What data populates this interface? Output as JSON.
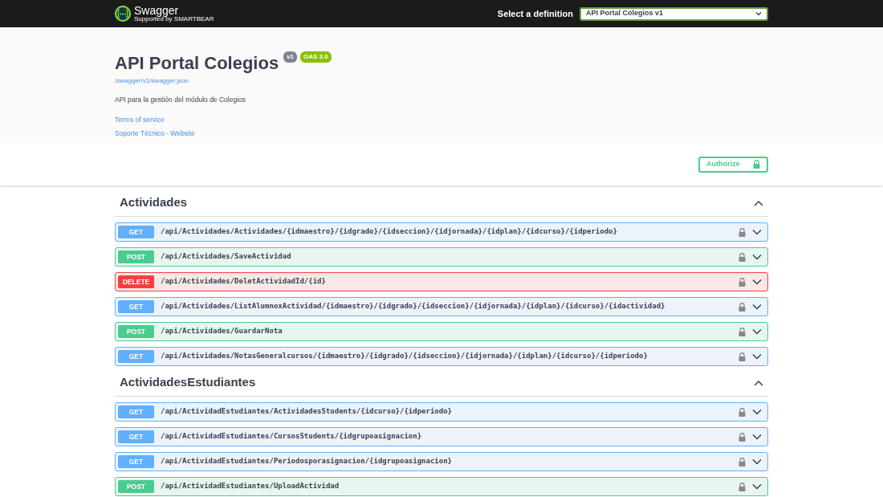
{
  "topbar": {
    "brand": "Swagger",
    "brand_sub": "Supported by SMARTBEAR",
    "definition_label": "Select a definition",
    "definition_value": "API Portal Colegios v1"
  },
  "info": {
    "title": "API Portal Colegios",
    "version": "v1",
    "oas": "OAS 3.0",
    "spec_url": "/swagger/v1/swagger.json",
    "description": "API para la gestión del módulo de Colegios",
    "links": [
      "Terms of service",
      "Soporte Técnico - Website"
    ]
  },
  "authorize": {
    "label": "Authorize"
  },
  "sections": [
    {
      "name": "Actividades",
      "expanded": true,
      "operations": [
        {
          "kind": "get",
          "method": "GET",
          "path": "/api/Actividades/Actividades/{idmaestro}/{idgrado}/{idseccion}/{idjornada}/{idplan}/{idcurso}/{idperiodo}"
        },
        {
          "kind": "post",
          "method": "POST",
          "path": "/api/Actividades/SaveActividad"
        },
        {
          "kind": "delete",
          "method": "DELETE",
          "path": "/api/Actividades/DeletActividadId/{id}"
        },
        {
          "kind": "get",
          "method": "GET",
          "path": "/api/Actividades/ListAlumnoxActividad/{idmaestro}/{idgrado}/{idseccion}/{idjornada}/{idplan}/{idcurso}/{idactividad}"
        },
        {
          "kind": "post",
          "method": "POST",
          "path": "/api/Actividades/GuardarNota"
        },
        {
          "kind": "get",
          "method": "GET",
          "path": "/api/Actividades/NotasGeneralcursos/{idmaestro}/{idgrado}/{idseccion}/{idjornada}/{idplan}/{idcurso}/{idperiodo}"
        }
      ]
    },
    {
      "name": "ActividadesEstudiantes",
      "expanded": true,
      "operations": [
        {
          "kind": "get",
          "method": "GET",
          "path": "/api/ActividadEstudiantes/ActividadesStudents/{idcurso}/{idperiodo}"
        },
        {
          "kind": "get",
          "method": "GET",
          "path": "/api/ActividadEstudiantes/CursosStudents/{idgrupoasignacion}"
        },
        {
          "kind": "get",
          "method": "GET",
          "path": "/api/ActividadEstudiantes/Periodosporasignacion/{idgrupoasignacion}"
        },
        {
          "kind": "post",
          "method": "POST",
          "path": "/api/ActividadEstudiantes/UploadActividad"
        }
      ]
    }
  ]
}
